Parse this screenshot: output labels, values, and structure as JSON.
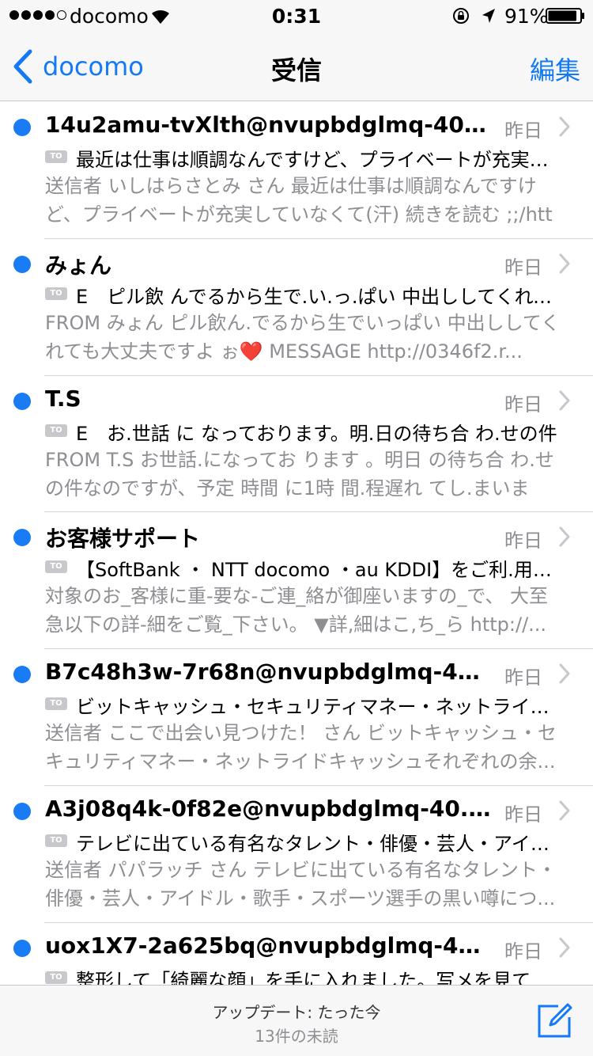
{
  "status": {
    "carrier": "docomo",
    "time": "0:31",
    "battery": "91%",
    "signal_bars_filled": 4,
    "signal_bars_total": 5,
    "battery_level": 0.91
  },
  "nav": {
    "back_label": "docomo",
    "title": "受信",
    "edit_label": "編集"
  },
  "messages": [
    {
      "sender": "14u2amu-tvXlth@nvupbdglmq-40.com",
      "date": "昨日",
      "to_badge": "TO",
      "subject": "最近は仕事は順調なんですけど、プライベートが充実していなくて",
      "preview": "送信者 いしはらさとみ さん 最近は仕事は順調なんですけど、プライベートが充実していなくて(汗) 続きを読む ;;/http"
    },
    {
      "sender": "みょん",
      "date": "昨日",
      "to_badge": "TO",
      "subject": "E　ピル飲 んでるから生で.い.っ.ぱい 中出ししてくれても",
      "preview": "FROM みょん ピル飲ん.でるから生でいっぱい 中出ししてくれても大丈夫ですよ ぉ❤️ MESSAGE http://0346f2.r..."
    },
    {
      "sender": "T.S",
      "date": "昨日",
      "to_badge": "TO",
      "subject": "E　お.世話 に なっております。明.日の待ち合 わ.せの件",
      "preview": "FROM T.S お世話.になってお ります 。明日 の待ち合 わ.せの件なのですが、予定 時間 に1時 間.程遅れ てし.まいます..."
    },
    {
      "sender": "お客様サポート",
      "date": "昨日",
      "to_badge": "TO",
      "subject": "【SoftBank ・ NTT docomo ・au KDDI】をご利.用のお客様へ",
      "preview": "対象のお_客様に重-要な-ご連_絡が御座いますの_で、 大至急以下の詳-細をご覧_下さい。 ▼詳,細はこ,ち_ら http://..."
    },
    {
      "sender": "B7c48h3w-7r68n@nvupbdglmq-40.com",
      "date": "昨日",
      "to_badge": "TO",
      "subject": "ビットキャッシュ・セキュリティマネー・ネットライドキャッシュ",
      "preview": "送信者 ここで出会い見つけた！ さん ビットキャッシュ・セキュリティマネー・ネットライドキャッシュそれぞれの余..."
    },
    {
      "sender": "A3j08q4k-0f82e@nvupbdglmq-40.com",
      "date": "昨日",
      "to_badge": "TO",
      "subject": "テレビに出ている有名なタレント・俳優・芸人・アイドル",
      "preview": "送信者 パパラッチ さん テレビに出ている有名なタレント・俳優・芸人・アイドル・歌手・スポーツ選手の黒い噂につ..."
    },
    {
      "sender": "uox1X7-2a625bq@nvupbdglmq-40.com",
      "date": "昨日",
      "to_badge": "TO",
      "subject": "整形して「綺麗な顔」を手に入れました。写メを見てください",
      "preview": ""
    }
  ],
  "toolbar": {
    "update_text": "アップデート: たった今",
    "unread_text": "13件の未読"
  },
  "colors": {
    "accent": "#1479f6",
    "unread_dot": "#1a7cf5",
    "secondary_text": "#8e8e93"
  }
}
